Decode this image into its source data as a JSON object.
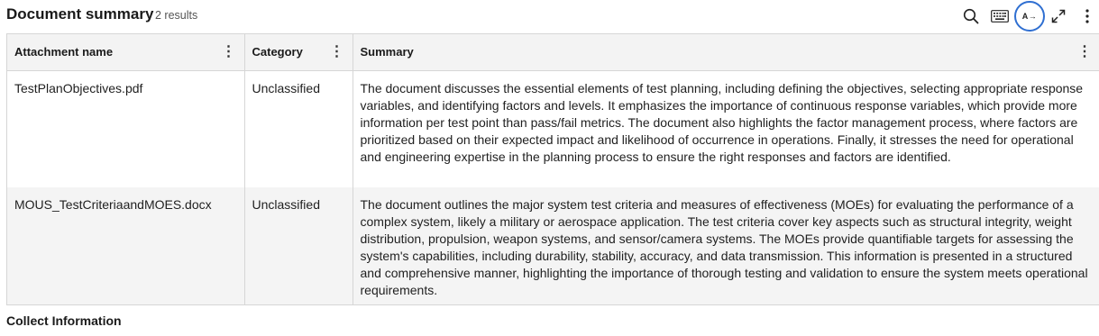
{
  "panel": {
    "title": "Document summary",
    "result_count": "2 results"
  },
  "toolbar": {
    "search_icon": "search-icon",
    "keyboard_icon": "keyboard-icon",
    "translate_label": "A→",
    "expand_icon": "expand-icon",
    "more_icon": "more-vertical-icon",
    "accent_color": "#2f6fd1"
  },
  "table": {
    "columns": [
      "Attachment name",
      "Category",
      "Summary"
    ],
    "rows": [
      {
        "attachment": "TestPlanObjectives.pdf",
        "category": "Unclassified",
        "summary": "The document discusses the essential elements of test planning, including defining the objectives, selecting appropriate response variables, and identifying factors and levels. It emphasizes the importance of continuous response variables, which provide more information per test point than pass/fail metrics. The document also highlights the factor management process, where factors are prioritized based on their expected impact and likelihood of occurrence in operations. Finally, it stresses the need for operational and engineering expertise in the planning process to ensure the right responses and factors are identified."
      },
      {
        "attachment": "MOUS_TestCriteriaandMOES.docx",
        "category": "Unclassified",
        "summary": "The document outlines the major system test criteria and measures of effectiveness (MOEs) for evaluating the performance of a complex system, likely a military or aerospace application. The test criteria cover key aspects such as structural integrity, weight distribution, propulsion, weapon systems, and sensor/camera systems. The MOEs provide quantifiable targets for assessing the system's capabilities, including durability, stability, accuracy, and data transmission. This information is presented in a structured and comprehensive manner, highlighting the importance of thorough testing and validation to ensure the system meets operational requirements."
      }
    ]
  },
  "footer": {
    "section_label": "Collect Information"
  }
}
